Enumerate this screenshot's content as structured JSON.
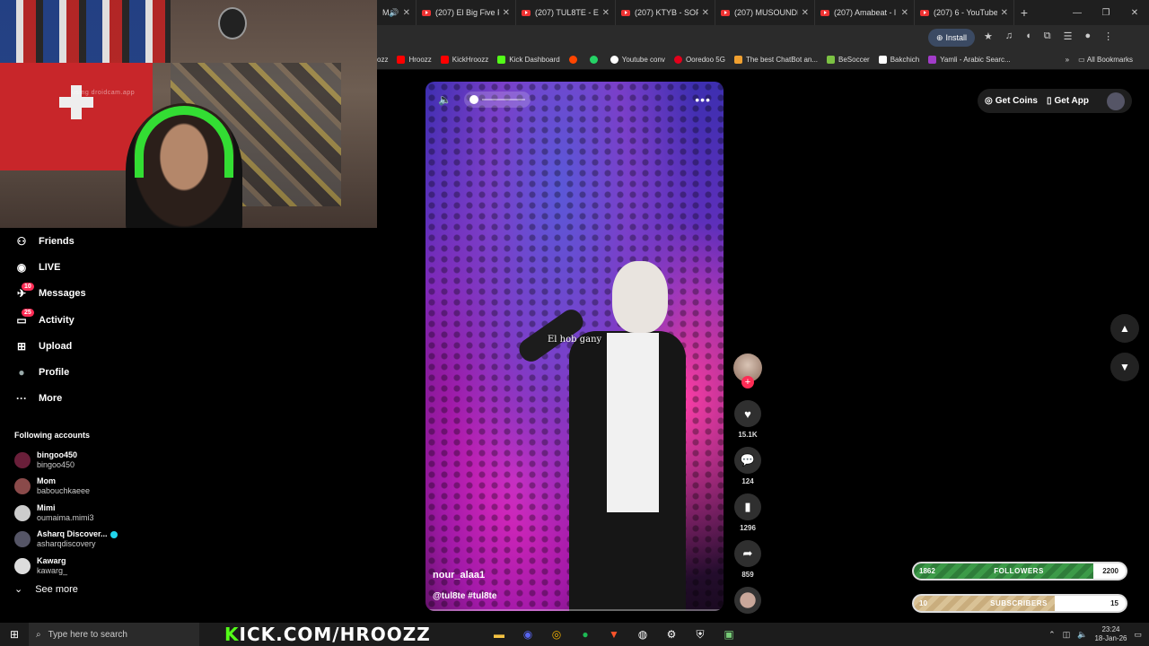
{
  "browser": {
    "tabs": [
      {
        "label": "M"
      },
      {
        "label": "(207) El Big Five F"
      },
      {
        "label": "(207) TUL8TE - El"
      },
      {
        "label": "(207) KTYB - SOFI"
      },
      {
        "label": "(207) MUSOUNDI"
      },
      {
        "label": "(207) Amabeat - l"
      },
      {
        "label": "(207) 6 - YouTube"
      }
    ],
    "new_tab": "+",
    "install_label": "Install",
    "bookmarks": [
      {
        "label": "ozz",
        "color": "#ff0000"
      },
      {
        "label": "Hroozz",
        "color": "#ff0000"
      },
      {
        "label": "KickHroozz",
        "color": "#ff0000"
      },
      {
        "label": "Kick Dashboard",
        "color": "#53fc18"
      },
      {
        "label": "",
        "color": "#ff4500"
      },
      {
        "label": "",
        "color": "#25d366"
      },
      {
        "label": "Youtube conv",
        "color": "#ffffff"
      },
      {
        "label": "Ooredoo 5G",
        "color": "#e3001b"
      },
      {
        "label": "The best ChatBot an...",
        "color": "#f0a030"
      },
      {
        "label": "BeSoccer",
        "color": "#7cc243"
      },
      {
        "label": "Bakchich",
        "color": "#ffffff"
      },
      {
        "label": "Yamli - Arabic Searc...",
        "color": "#a23cc9"
      }
    ],
    "all_bookmarks": "All Bookmarks"
  },
  "webcam": {
    "watermark": "using droidcam.app"
  },
  "sidebar": {
    "items": [
      {
        "label": "Friends",
        "icon": "friends-icon",
        "glyph": "⚇"
      },
      {
        "label": "LIVE",
        "icon": "live-icon",
        "glyph": "◉"
      },
      {
        "label": "Messages",
        "icon": "messages-icon",
        "glyph": "✈",
        "badge": "10"
      },
      {
        "label": "Activity",
        "icon": "activity-icon",
        "glyph": "▭",
        "badge": "25"
      },
      {
        "label": "Upload",
        "icon": "upload-icon",
        "glyph": "⊞"
      },
      {
        "label": "Profile",
        "icon": "profile-icon",
        "glyph": "●"
      },
      {
        "label": "More",
        "icon": "more-icon",
        "glyph": "···"
      }
    ],
    "following_title": "Following accounts",
    "accounts": [
      {
        "name": "bingoo450",
        "handle": "bingoo450",
        "color": "#6a1f3a"
      },
      {
        "name": "Mom",
        "handle": "babouchkaeee",
        "color": "#8a4a4a"
      },
      {
        "name": "Mimi",
        "handle": "oumaima.mimi3",
        "color": "#cccccc"
      },
      {
        "name": "Asharq Discover...",
        "handle": "asharqdiscovery",
        "color": "#555566",
        "verified": true
      },
      {
        "name": "Kawarg",
        "handle": "kawarg_",
        "color": "#dddddd"
      }
    ],
    "see_more": "See more"
  },
  "video": {
    "caption": "El hob gany",
    "username": "nour_alaa1",
    "hashtags": "@tul8te #tul8te"
  },
  "actions": {
    "likes": "15.1K",
    "comments": "124",
    "saves": "1296",
    "shares": "859"
  },
  "top_right": {
    "get_coins": "Get Coins",
    "get_app": "Get App"
  },
  "goals": {
    "followers": {
      "current": "1862",
      "label": "FOLLOWERS",
      "target": "2200",
      "progress": 0.846
    },
    "subscribers": {
      "current": "10",
      "label": "SUBSCRIBERS",
      "target": "15",
      "progress": 0.667
    }
  },
  "taskbar": {
    "search_placeholder": "Type here to search",
    "kick_text": "ICK.COM/HROOZZ",
    "kick_k": "K",
    "time": "23:24",
    "date": "18-Jan-26"
  }
}
